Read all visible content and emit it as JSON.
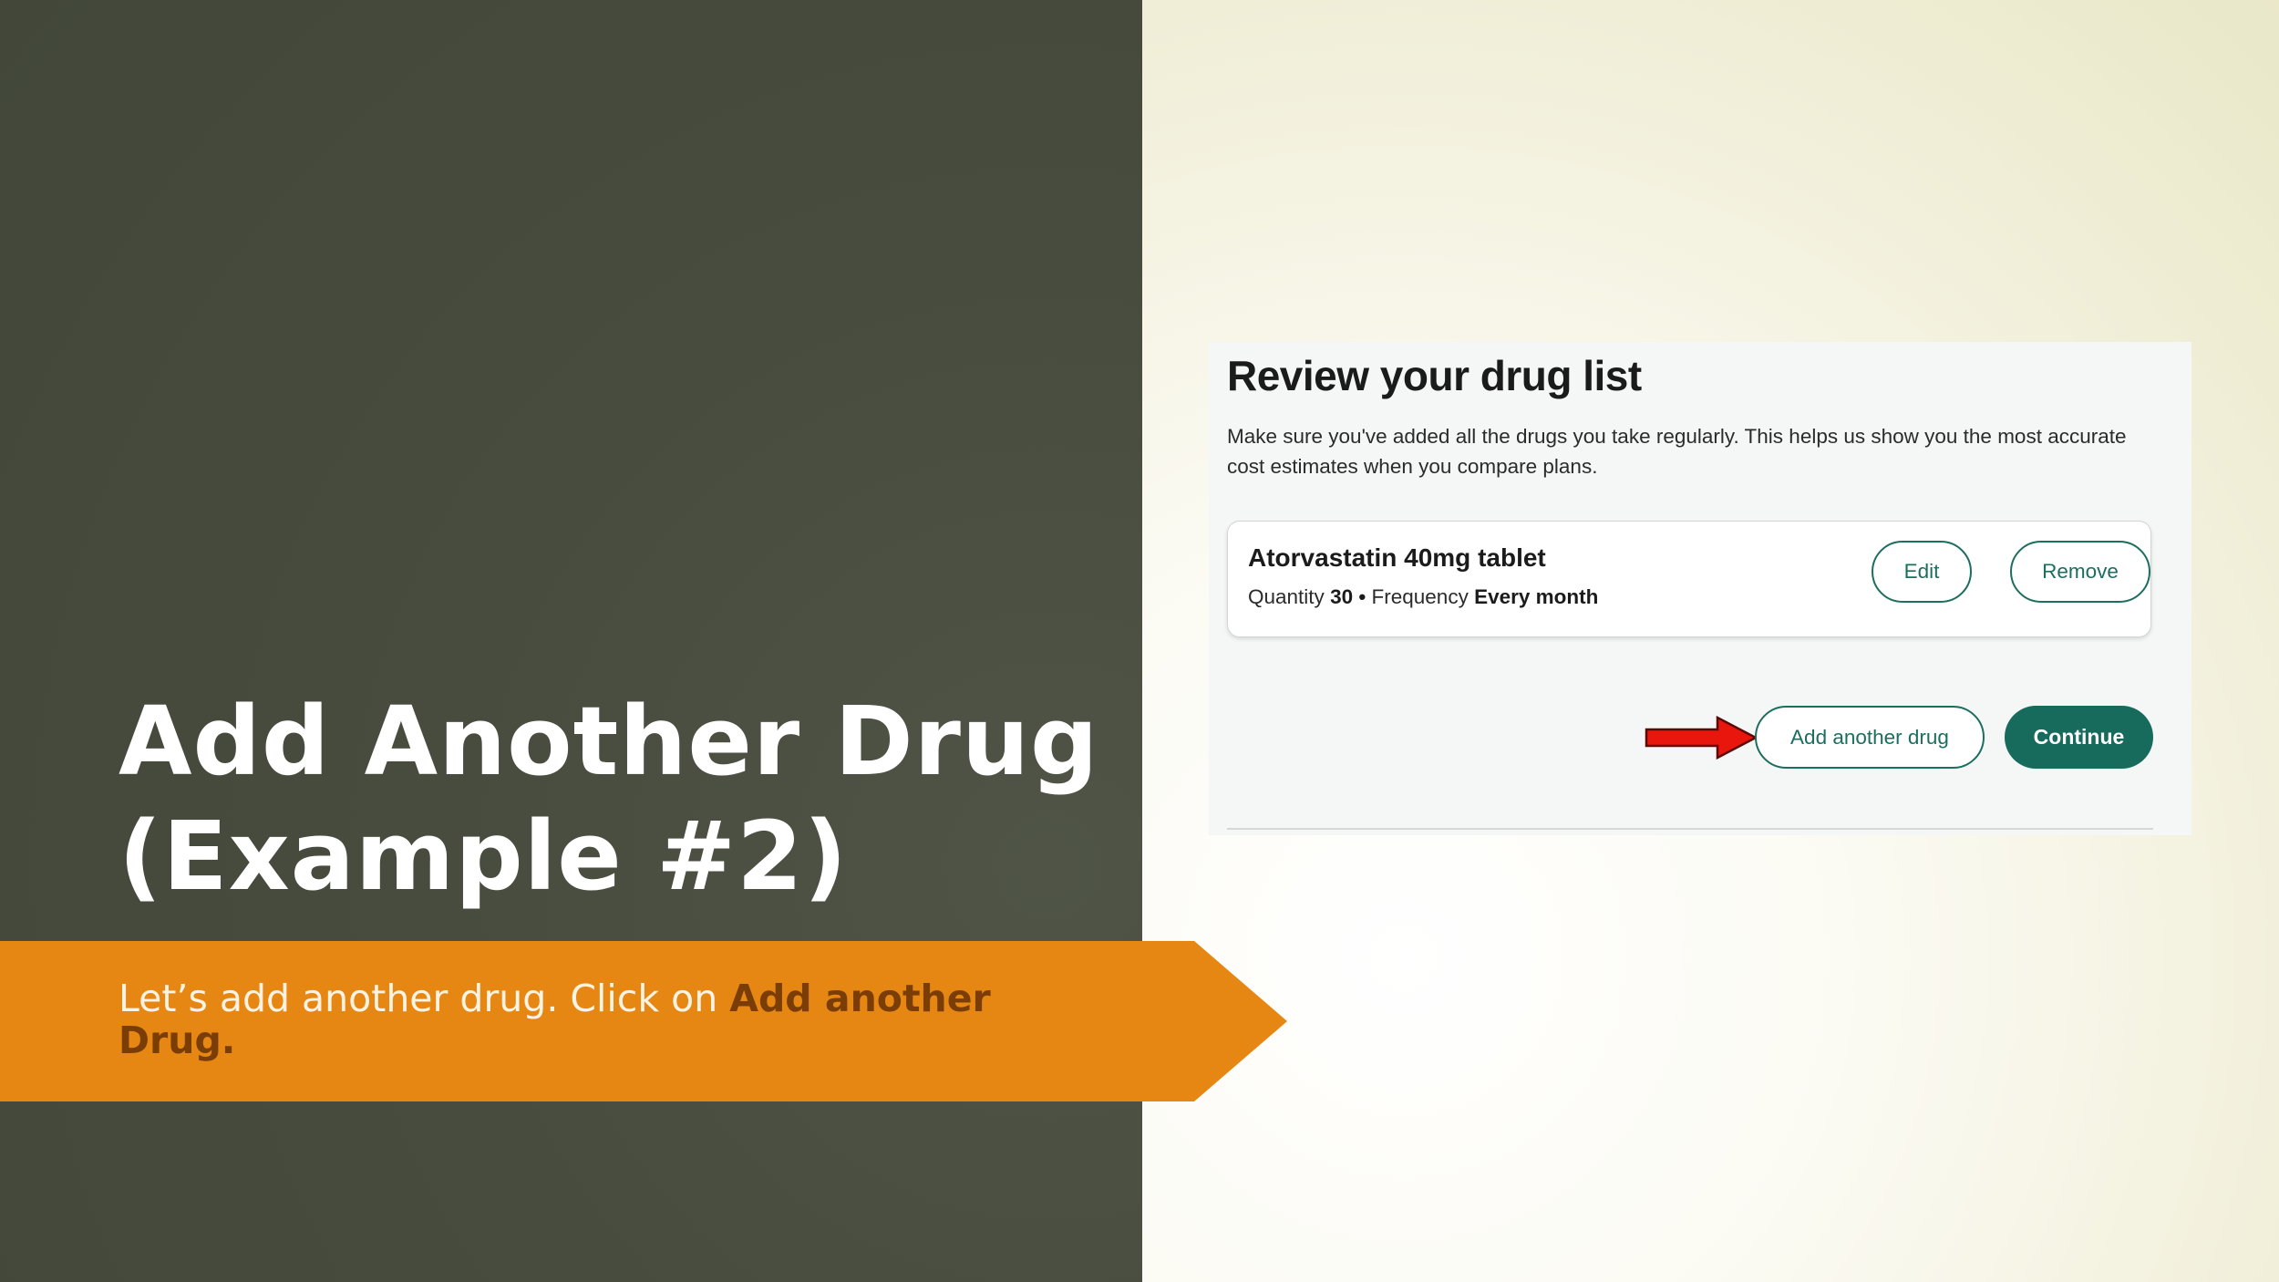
{
  "slide": {
    "title_line1": "Add Another Drug",
    "title_line2": "(Example #2)",
    "instruction_prefix": "Let’s add another drug.  Click on ",
    "instruction_bold": "Add another Drug",
    "instruction_suffix": "."
  },
  "screenshot": {
    "heading": "Review your drug list",
    "description": "Make sure you've added all the drugs you take regularly. This helps us show you the most accurate cost estimates when you compare plans.",
    "drug": {
      "name": "Atorvastatin 40mg tablet",
      "quantity_label": "Quantity",
      "quantity_value": "30",
      "separator": "•",
      "frequency_label": "Frequency",
      "frequency_value": "Every month"
    },
    "buttons": {
      "edit": "Edit",
      "remove": "Remove",
      "add_another": "Add another drug",
      "continue": "Continue"
    },
    "icons": {
      "pointer": "red-arrow-icon"
    }
  },
  "colors": {
    "left_panel": "#484c3e",
    "banner": "#e68613",
    "banner_bold_text": "#7a3d05",
    "accent_green": "#166b5c",
    "arrow_red": "#e8160c"
  }
}
